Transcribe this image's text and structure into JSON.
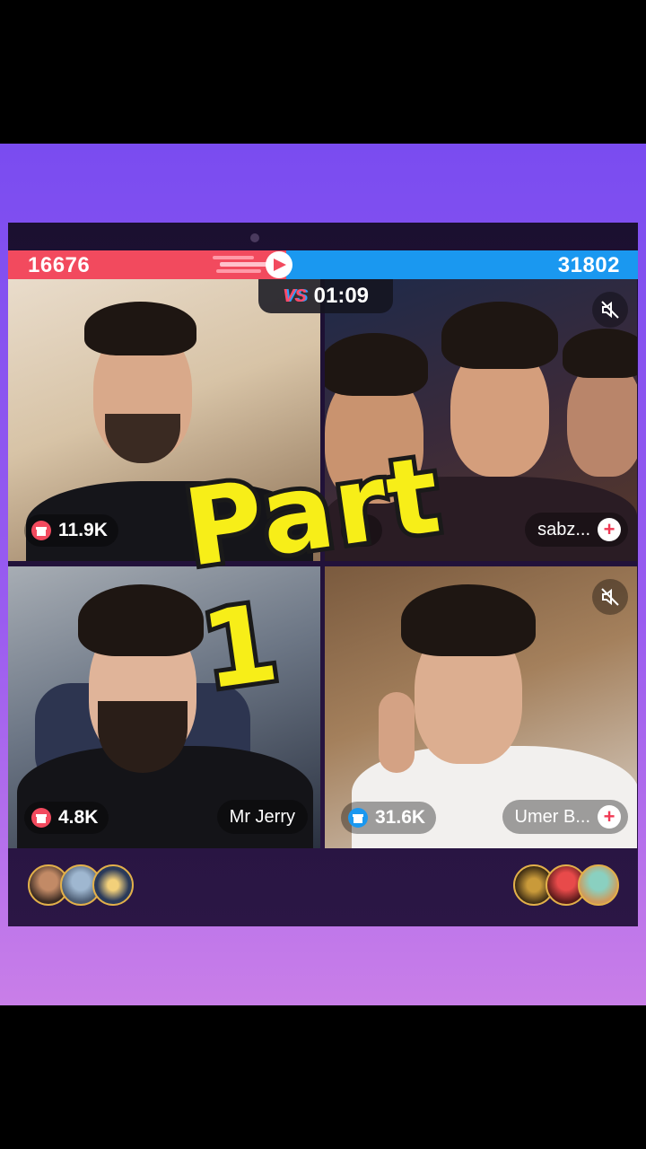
{
  "battle": {
    "left_score": "16676",
    "right_score": "31802",
    "left_fraction": 0.44,
    "timer": "01:09",
    "vs_label": "VS",
    "colors": {
      "left": "#f24a5e",
      "right": "#1a98f0"
    }
  },
  "tiles": [
    {
      "stat_value": "11.9K",
      "stat_icon": "red-gift-icon",
      "name": ""
    },
    {
      "stat_value": "",
      "stat_icon": "blue-gift-icon",
      "name": "sabz...",
      "muted": true
    },
    {
      "stat_value": "4.8K",
      "stat_icon": "red-gift-icon",
      "name": "Mr Jerry"
    },
    {
      "stat_value": "31.6K",
      "stat_icon": "blue-gift-icon",
      "name": "Umer B...",
      "muted": true
    }
  ],
  "overlay": {
    "text": "Part 1"
  },
  "plus_symbol": "+"
}
